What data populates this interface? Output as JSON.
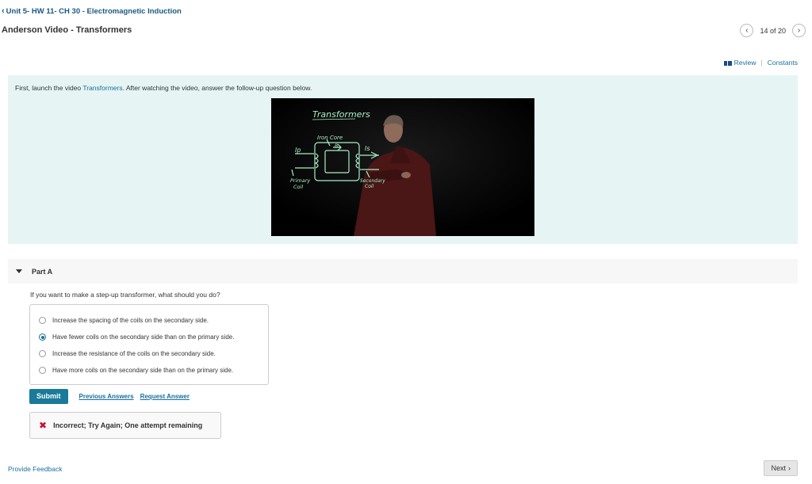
{
  "breadcrumb": {
    "chevron": "‹",
    "label": "Unit 5- HW 11- CH 30 - Electromagnetic Induction"
  },
  "page_title": "Anderson Video - Transformers",
  "pager": {
    "prev": "‹",
    "position": "14 of 20",
    "next": "›"
  },
  "top_links": {
    "review": "Review",
    "separator": "|",
    "constants": "Constants"
  },
  "intro": {
    "prefix": "First, launch the video ",
    "link": "Transformers",
    "suffix": ". After watching the video, answer the follow-up question below."
  },
  "video": {
    "board_title": "Transformers",
    "core_label": "Iron Core",
    "ip_label": "Ip",
    "is_label": "Is",
    "b_label": "B",
    "primary_label": [
      "Primary",
      "Coil"
    ],
    "secondary_label": [
      "Secondary",
      "Coil"
    ],
    "ink_color": "#a8f0c8"
  },
  "part": {
    "label": "Part A"
  },
  "question": "If you want to make a step-up transformer, what should you do?",
  "options": [
    {
      "text": "Increase the spacing of the coils on the secondary side.",
      "selected": false
    },
    {
      "text": "Have fewer coils on the secondary side than on the primary side.",
      "selected": true
    },
    {
      "text": "Increase the resistance of the coils on the secondary side.",
      "selected": false
    },
    {
      "text": "Have more coils on the secondary side than on the primary side.",
      "selected": false
    }
  ],
  "actions": {
    "submit": "Submit",
    "previous_answers": "Previous Answers",
    "request_answer": "Request Answer"
  },
  "feedback": {
    "icon": "✖",
    "message": "Incorrect; Try Again; One attempt remaining"
  },
  "footer": {
    "provide_feedback": "Provide Feedback",
    "next": "Next",
    "next_chevron": "›"
  },
  "colors": {
    "link": "#1a6fa0",
    "submit_bg": "#1a7a9a",
    "panel_bg": "#e6f4f4",
    "error": "#c8102e"
  }
}
